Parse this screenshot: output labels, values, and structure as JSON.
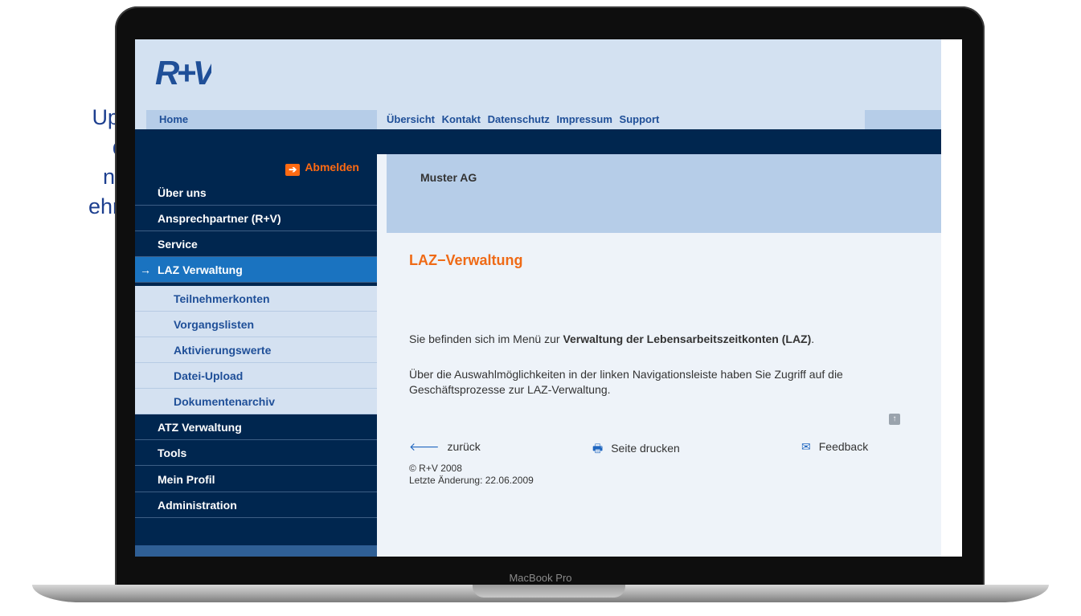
{
  "caption": {
    "lines": [
      "Upload",
      "dung",
      "n csv-",
      "ehmen."
    ]
  },
  "device": {
    "model_label": "MacBook Pro"
  },
  "brand": {
    "logo_text": "R+V",
    "logo_color": "#1f4f98"
  },
  "nav": {
    "home": "Home",
    "top_links": [
      "Übersicht",
      "Kontakt",
      "Datenschutz",
      "Impressum",
      "Support"
    ]
  },
  "sidebar": {
    "logout_label": "Abmelden",
    "items": [
      {
        "label": "Über uns"
      },
      {
        "label": "Ansprechpartner (R+V)"
      },
      {
        "label": "Service"
      },
      {
        "label": "LAZ Verwaltung",
        "active": true
      },
      {
        "label": "ATZ Verwaltung"
      },
      {
        "label": "Tools"
      },
      {
        "label": "Mein Profil"
      },
      {
        "label": "Administration"
      }
    ],
    "subitems": [
      "Teilnehmerkonten",
      "Vorgangslisten",
      "Aktivierungswerte",
      "Datei-Upload",
      "Dokumentenarchiv"
    ]
  },
  "content": {
    "company": "Muster AG",
    "title": "LAZ−Verwaltung",
    "para1_prefix": "Sie befinden sich im Menü zur ",
    "para1_bold": "Verwaltung der Lebensarbeitszeitkonten (LAZ)",
    "para1_suffix": ".",
    "para2": "Über die Auswahlmöglichkeiten in der linken Navigationsleiste haben Sie Zugriff auf die Geschäftsprozesse zur LAZ-Verwaltung.",
    "back_label": "zurück",
    "print_label": "Seite drucken",
    "feedback_label": "Feedback",
    "copyright": "© R+V 2008",
    "last_change": "Letzte Änderung: 22.06.2009"
  },
  "colors": {
    "accent_orange": "#ef6a16",
    "nav_dark": "#00264f",
    "active_blue": "#1a73c0",
    "light_blue": "#d3e1f1"
  }
}
